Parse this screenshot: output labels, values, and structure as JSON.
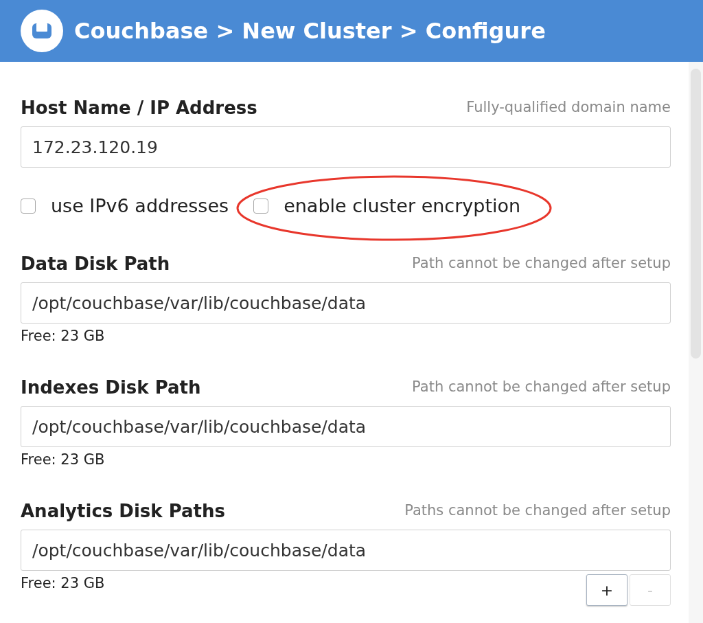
{
  "header": {
    "title": "Couchbase > New Cluster > Configure"
  },
  "host": {
    "label": "Host Name / IP Address",
    "hint": "Fully-qualified domain name",
    "value": "172.23.120.19"
  },
  "options": [
    {
      "label": "use IPv6 addresses",
      "checked": false,
      "circled": false
    },
    {
      "label": "enable cluster encryption",
      "checked": false,
      "circled": true
    }
  ],
  "paths": [
    {
      "label": "Data Disk Path",
      "hint": "Path cannot be changed after setup",
      "value": "/opt/couchbase/var/lib/couchbase/data",
      "free": "Free: 23 GB"
    },
    {
      "label": "Indexes Disk Path",
      "hint": "Path cannot be changed after setup",
      "value": "/opt/couchbase/var/lib/couchbase/data",
      "free": "Free: 23 GB"
    },
    {
      "label": "Analytics Disk Paths",
      "hint": "Paths cannot be changed after setup",
      "value": "/opt/couchbase/var/lib/couchbase/data",
      "free": "Free: 23 GB",
      "buttons": [
        {
          "label": "+",
          "disabled": false
        },
        {
          "label": "-",
          "disabled": true
        }
      ]
    }
  ]
}
